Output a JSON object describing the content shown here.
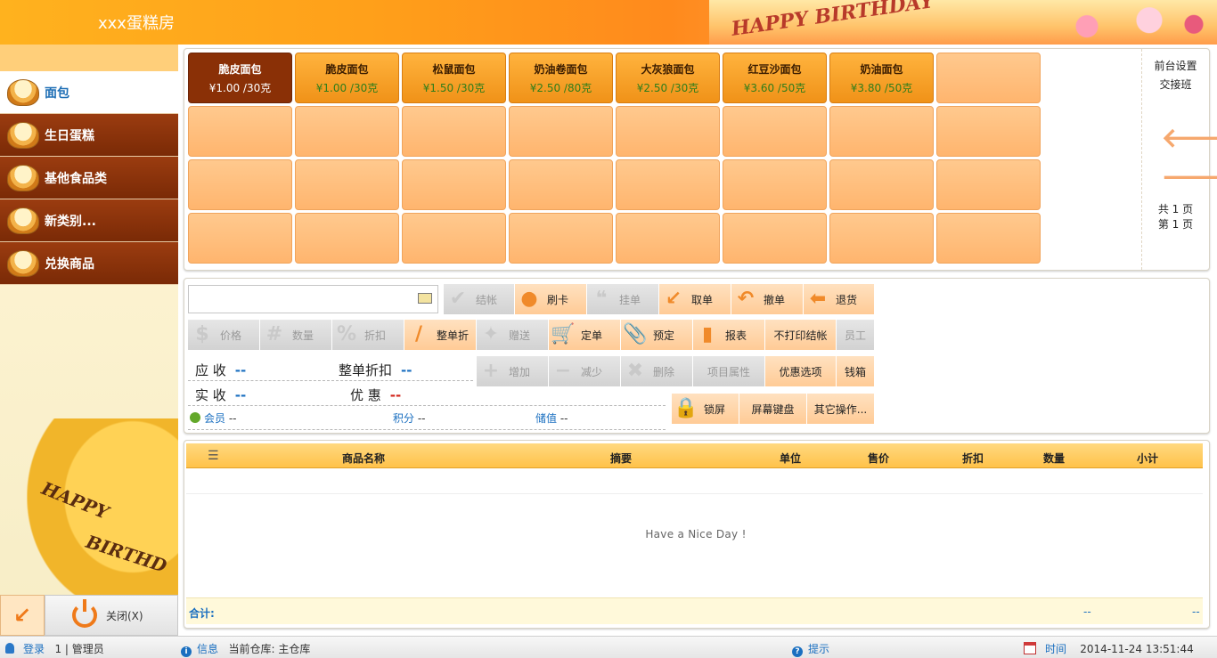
{
  "app": {
    "title": "xxx蛋糕房",
    "banner_text": "HAPPY BIRTHDAY"
  },
  "sidebar": {
    "items": [
      {
        "label": "面包",
        "active": true
      },
      {
        "label": "生日蛋糕",
        "active": false
      },
      {
        "label": "基他食品类",
        "active": false
      },
      {
        "label": "新类别...",
        "active": false
      },
      {
        "label": "兑换商品",
        "active": false
      }
    ],
    "decor_text_1": "HAPPY",
    "decor_text_2": "BIRTHD",
    "close_label": "关闭(X)"
  },
  "products": [
    {
      "name": "脆皮面包",
      "price": "¥1.00 /30克"
    },
    {
      "name": "脆皮面包",
      "price": "¥1.00 /30克"
    },
    {
      "name": "松鼠面包",
      "price": "¥1.50 /30克"
    },
    {
      "name": "奶油卷面包",
      "price": "¥2.50 /80克"
    },
    {
      "name": "大灰狼面包",
      "price": "¥2.50 /30克"
    },
    {
      "name": "红豆沙面包",
      "price": "¥3.60 /50克"
    },
    {
      "name": "奶油面包",
      "price": "¥3.80 /50克"
    }
  ],
  "side_menu": {
    "settings": "前台设置",
    "shift": "交接班",
    "total_pages": "共 1 页",
    "current_page": "第 1 页"
  },
  "ops": {
    "search_placeholder": "",
    "row1": [
      {
        "label": "结帐",
        "icon": "✔",
        "enabled": false
      },
      {
        "label": "刷卡",
        "icon": "●",
        "enabled": true
      },
      {
        "label": "挂单",
        "icon": "❝",
        "enabled": false
      },
      {
        "label": "取单",
        "icon": "↙",
        "enabled": true
      },
      {
        "label": "撤单",
        "icon": "↶",
        "enabled": true
      },
      {
        "label": "退货",
        "icon": "⬅",
        "enabled": true
      }
    ],
    "row2": [
      {
        "label": "价格",
        "icon": "$",
        "enabled": false
      },
      {
        "label": "数量",
        "icon": "#",
        "enabled": false
      },
      {
        "label": "折扣",
        "icon": "%",
        "enabled": false
      },
      {
        "label": "整单折",
        "icon": "/",
        "enabled": true
      },
      {
        "label": "赠送",
        "icon": "✦",
        "enabled": false
      },
      {
        "label": "定单",
        "icon": "🛒",
        "enabled": true
      },
      {
        "label": "预定",
        "icon": "📎",
        "enabled": true
      },
      {
        "label": "报表",
        "icon": "▮",
        "enabled": true
      },
      {
        "label": "不打印结帐",
        "icon": "",
        "enabled": true
      },
      {
        "label": "员工",
        "icon": "",
        "enabled": false
      }
    ],
    "row3": [
      {
        "label": "增加",
        "icon": "+",
        "enabled": false
      },
      {
        "label": "减少",
        "icon": "−",
        "enabled": false
      },
      {
        "label": "删除",
        "icon": "✖",
        "enabled": false
      },
      {
        "label": "项目属性",
        "icon": "",
        "enabled": false
      },
      {
        "label": "优惠选项",
        "icon": "",
        "enabled": true
      },
      {
        "label": "钱箱",
        "icon": "",
        "enabled": true
      }
    ],
    "row4": [
      {
        "label": "锁屏",
        "icon": "🔒",
        "enabled": true
      },
      {
        "label": "屏幕键盘",
        "icon": "",
        "enabled": true
      },
      {
        "label": "其它操作...",
        "icon": "",
        "enabled": true
      }
    ],
    "receivable_label": "应 收",
    "receivable_value": "--",
    "order_discount_label": "整单折扣",
    "order_discount_value": "--",
    "received_label": "实 收",
    "received_value": "--",
    "discount_label": "优 惠",
    "discount_value": "--",
    "member_label": "会员",
    "member_value": "--",
    "points_label": "积分",
    "points_value": "--",
    "stored_label": "储值",
    "stored_value": "--"
  },
  "orders": {
    "columns": [
      "商品名称",
      "摘要",
      "单位",
      "售价",
      "折扣",
      "数量",
      "小计"
    ],
    "empty_text": "Have a Nice Day !",
    "total_label": "合计:",
    "total_qty": "--",
    "total_amount": "--"
  },
  "status": {
    "login_label": "登录",
    "login_user": "1 | 管理员",
    "info_label": "信息",
    "warehouse": "当前仓库: 主仓库",
    "hint_label": "提示",
    "time_label": "时间",
    "time_value": "2014-11-24 13:51:44"
  }
}
